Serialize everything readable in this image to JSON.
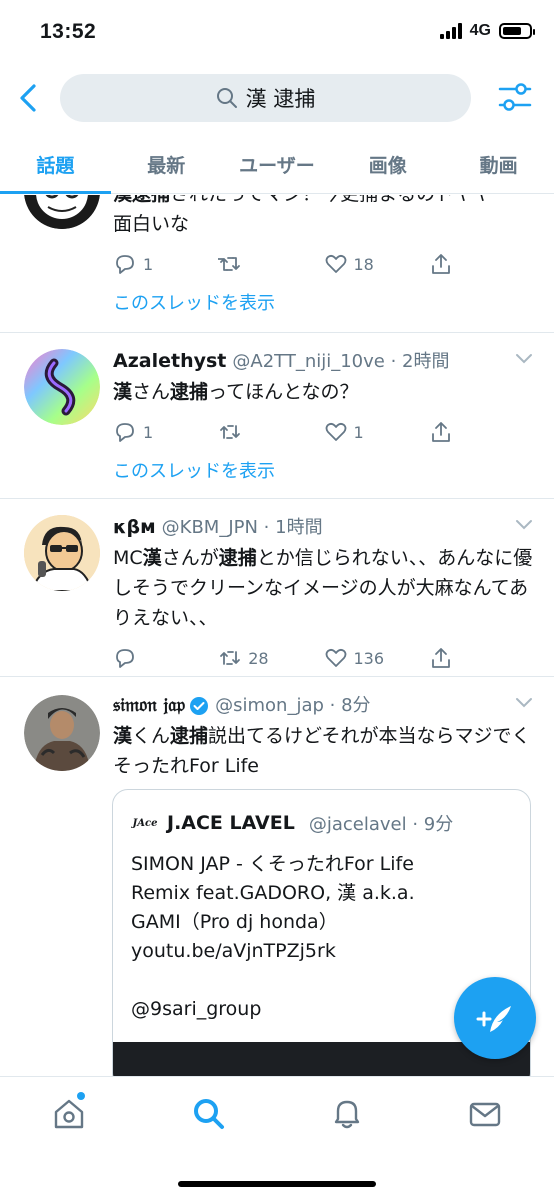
{
  "status_bar": {
    "time": "13:52",
    "network": "4G"
  },
  "search": {
    "query": "漢 逮捕"
  },
  "tabs": [
    {
      "label": "話題"
    },
    {
      "label": "最新"
    },
    {
      "label": "ユーザー"
    },
    {
      "label": "画像"
    },
    {
      "label": "動画"
    }
  ],
  "tweets": [
    {
      "name": "",
      "handle": "",
      "text_partial": [
        "漢逮捕",
        "されたってマジ？今更捕まるのドヤヤ",
        "面白いな"
      ],
      "replies": "1",
      "retweets": "",
      "likes": "18",
      "thread_link": "このスレッドを表示"
    },
    {
      "name": "Azalethyst",
      "handle": "@A2TT_niji_10ve · 2時間",
      "text": [
        "漢",
        "さん",
        "逮捕",
        "ってほんとなの？"
      ],
      "replies": "1",
      "retweets": "",
      "likes": "1",
      "thread_link": "このスレッドを表示"
    },
    {
      "name": "κβм",
      "handle": "@KBM_JPN · 1時間",
      "text": [
        "MC",
        "漢",
        "さんが",
        "逮捕",
        "とか信じられない、、あんなに優しそうでクリーンなイメージの人が大麻なんてありえない、、"
      ],
      "replies": "",
      "retweets": "28",
      "likes": "136"
    },
    {
      "name": "𝔰𝔦𝔪𝔬𝔫 𝔧𝔞𝔭",
      "handle": "@simon_jap · 8分",
      "text": [
        "漢",
        "くん",
        "逮捕",
        "説出てるけどそれが本当ならマジでくそったれFor Life"
      ],
      "quote": {
        "logo_text": "JAce",
        "name": "J.ACE LAVEL",
        "handle": "@jacelavel · 9分",
        "lines": [
          "SIMON JAP - くそったれFor Life",
          "Remix feat.GADORO, 漢 a.k.a.",
          "GAMI（Pro dj honda）",
          "youtu.be/aVjnTPZj5rk",
          "",
          "@9sari_group"
        ]
      }
    }
  ],
  "colors": {
    "accent": "#1da1f2",
    "secondary_text": "#657786",
    "divider": "#e1e8ed",
    "search_bg": "#e6ecf0"
  }
}
